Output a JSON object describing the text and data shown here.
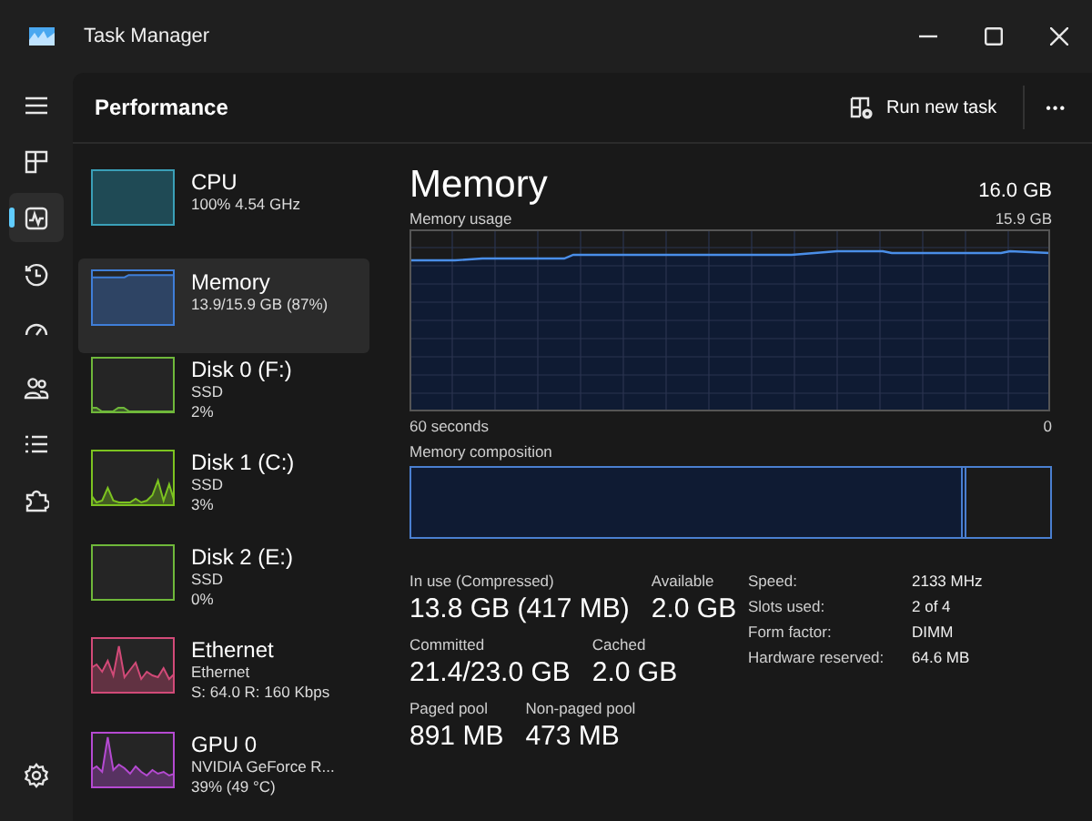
{
  "window": {
    "title": "Task Manager"
  },
  "nav": [
    {
      "selected": false
    },
    {
      "selected": false
    },
    {
      "selected": true
    },
    {
      "selected": false
    },
    {
      "selected": false
    },
    {
      "selected": false
    },
    {
      "selected": false
    },
    {
      "selected": false
    }
  ],
  "settings": {
    "selected": false
  },
  "header": {
    "title": "Performance",
    "action": "Run new task",
    "more": "•••"
  },
  "devices": [
    {
      "name": "CPU",
      "lines": [
        "100%  4.54 GHz"
      ],
      "color": "#3aa0b8",
      "selected": false
    },
    {
      "name": "Memory",
      "lines": [
        "13.9/15.9 GB (87%)"
      ],
      "color": "#3f7fd9",
      "selected": true
    },
    {
      "name": "Disk 0 (F:)",
      "lines": [
        "SSD",
        "2%"
      ],
      "color": "#6fb83a",
      "selected": false
    },
    {
      "name": "Disk 1 (C:)",
      "lines": [
        "SSD",
        "3%"
      ],
      "color": "#7cc320",
      "selected": false
    },
    {
      "name": "Disk 2 (E:)",
      "lines": [
        "SSD",
        "0%"
      ],
      "color": "#6fb83a",
      "selected": false
    },
    {
      "name": "Ethernet",
      "lines": [
        "Ethernet",
        "S: 64.0  R: 160 Kbps"
      ],
      "color": "#d24a78",
      "selected": false
    },
    {
      "name": "GPU 0",
      "lines": [
        "NVIDIA GeForce R...",
        "39%  (49 °C)"
      ],
      "color": "#b54ad2",
      "selected": false
    }
  ],
  "detail": {
    "title": "Memory",
    "total": "16.0 GB",
    "graph_label": "Memory usage",
    "graph_max": "15.9 GB",
    "time_span": "60 seconds",
    "time_end": "0",
    "composition_label": "Memory composition",
    "composition": {
      "level": 0.87
    },
    "stats": [
      [
        {
          "label": "In use (Compressed)",
          "value": "13.8 GB (417 MB)"
        },
        {
          "label": "Available",
          "value": "2.0 GB"
        }
      ],
      [
        {
          "label": "Committed",
          "value": "21.4/23.0 GB"
        },
        {
          "label": "Cached",
          "value": "2.0 GB"
        }
      ],
      [
        {
          "label": "Paged pool",
          "value": "891 MB"
        },
        {
          "label": "Non-paged pool",
          "value": "473 MB"
        }
      ]
    ],
    "properties": [
      {
        "label": "Speed:",
        "value": "2133 MHz"
      },
      {
        "label": "Slots used:",
        "value": "2 of 4"
      },
      {
        "label": "Form factor:",
        "value": "DIMM"
      },
      {
        "label": "Hardware reserved:",
        "value": "64.6 MB"
      }
    ]
  }
}
